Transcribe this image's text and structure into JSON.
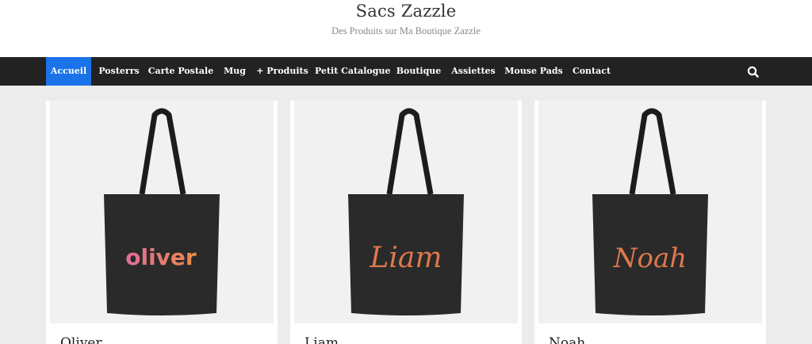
{
  "header": {
    "title": "Sacs Zazzle",
    "tagline": "Des Produits sur Ma Boutique Zazzle"
  },
  "nav": {
    "items": [
      {
        "label": "Accueil",
        "active": true
      },
      {
        "label": "Posterrs"
      },
      {
        "label": "Carte Postale"
      },
      {
        "label": "Mug"
      },
      {
        "label": "+ Produits"
      },
      {
        "label": "Petit Catalogue"
      },
      {
        "label": "Boutique"
      },
      {
        "label": "Assiettes"
      },
      {
        "label": "Mouse Pads"
      },
      {
        "label": "Contact"
      }
    ],
    "search_icon": "search-icon"
  },
  "products": [
    {
      "name": "Oliver",
      "bag_text": "oliver"
    },
    {
      "name": "Liam",
      "bag_text": "Liam"
    },
    {
      "name": "Noah",
      "bag_text": "Noah"
    }
  ],
  "colors": {
    "nav_bg": "#222222",
    "nav_active": "#1a73e8",
    "bag": "#2a2a2a",
    "print_orange": "#e0784a",
    "print_pink": "#e06c9a"
  }
}
